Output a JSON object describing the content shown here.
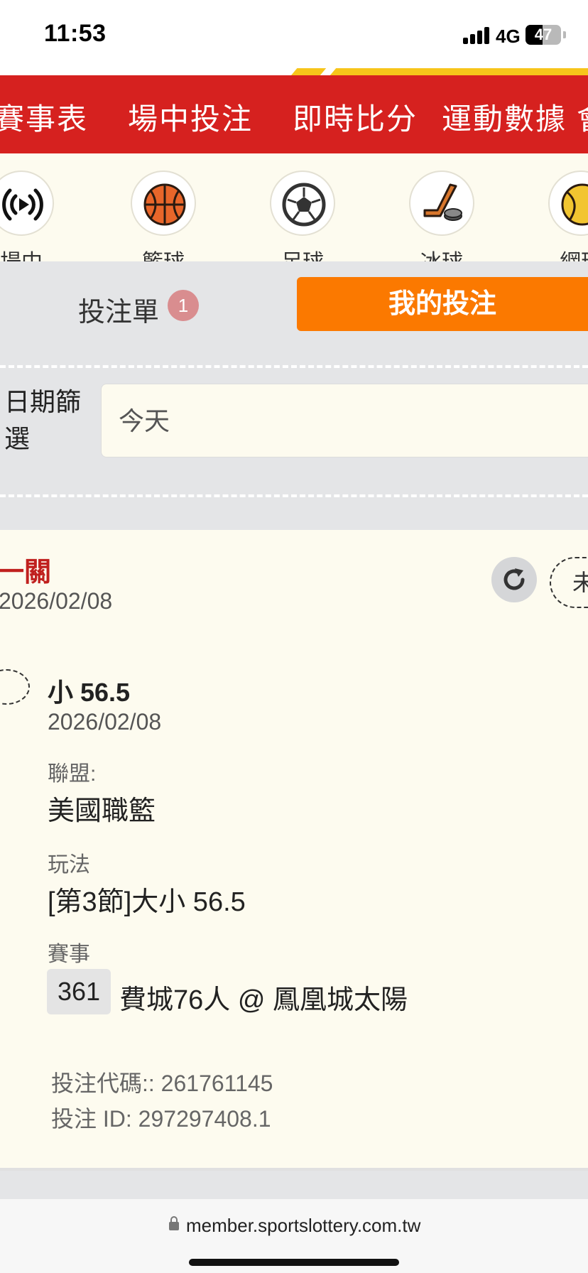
{
  "status_bar": {
    "time": "11:53",
    "network": "4G",
    "battery": "47",
    "battery_level": 0.47
  },
  "top_nav": {
    "items": [
      "賽事表",
      "場中投注",
      "即時比分",
      "運動數據",
      "會"
    ]
  },
  "sports": [
    {
      "label": "場中",
      "icon": "live-play-icon"
    },
    {
      "label": "籃球",
      "icon": "basketball-icon"
    },
    {
      "label": "足球",
      "icon": "soccer-ball-icon"
    },
    {
      "label": "冰球",
      "icon": "hockey-stick-icon"
    },
    {
      "label": "網球",
      "icon": "tennis-ball-icon"
    }
  ],
  "tabs": {
    "betslip_label": "投注單",
    "betslip_count": "1",
    "mybets_label": "我的投注"
  },
  "date_filter": {
    "label": "日期篩選",
    "value": "今天"
  },
  "bet": {
    "title": "一關",
    "date": "2026/02/08",
    "status": "未",
    "selection": "小 56.5",
    "leg_date": "2026/02/08",
    "league_label": "聯盟:",
    "league_value": "美國職籃",
    "market_label": "玩法",
    "market_value": "[第3節]大小 56.5",
    "event_label": "賽事",
    "event_number": "361",
    "event_name": "費城76人 @ 鳳凰城太陽",
    "bet_code": "投注代碼:: 261761145",
    "bet_id": "投注 ID: 297297408.1"
  },
  "browser": {
    "url": "member.sportslottery.com.tw"
  },
  "colors": {
    "brand_red": "#d6211f",
    "accent_orange": "#fb7900",
    "stripe_yellow": "#f7c51a",
    "card_bg": "#fdfbef",
    "title_red": "#c0201e"
  }
}
